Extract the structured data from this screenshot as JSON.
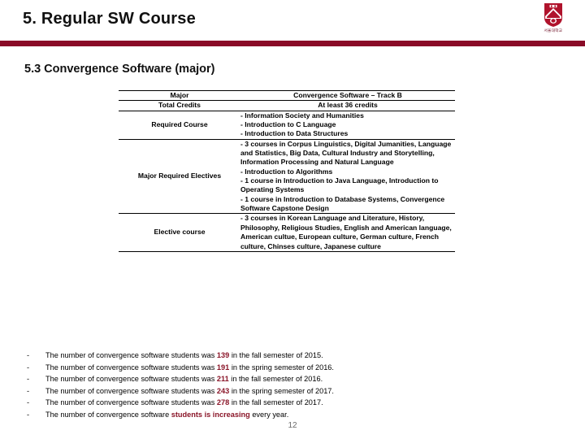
{
  "header": {
    "title": "5. Regular SW Course",
    "logo_icon": "university-crest-icon",
    "logo_caption": "서울대학교",
    "rule_color": "#8a0b27"
  },
  "section": {
    "heading": "5.3 Convergence Software (major)"
  },
  "table": {
    "rows": [
      {
        "label": "Major",
        "type": "single",
        "value": "Convergence Software – Track B"
      },
      {
        "label": "Total Credits",
        "type": "single",
        "value": "At least 36 credits"
      },
      {
        "label": "Required Course",
        "type": "list",
        "lines": [
          "- Information Society and Humanities",
          "- Introduction to C Language",
          "- Introduction to Data Structures"
        ]
      },
      {
        "label": "Major Required Electives",
        "type": "list",
        "lines": [
          "- 3 courses in Corpus Linguistics, Digital Jumanities, Language and Statistics, Big Data, Cultural Industry and Storytelling, Information Processing and Natural Language",
          "- Introduction to Algorithms",
          "- 1 course in Introduction to Java Language, Introduction to Operating Systems",
          "- 1 course in Introduction to Database Systems, Convergence Software Capstone Design"
        ]
      },
      {
        "label": "Elective course",
        "type": "list",
        "lines": [
          "- 3 courses in Korean Language and Literature, History, Philosophy, Religious Studies, English and American language, American cultue, European culture, German culture, French culture, Chinses culture, Japanese culture"
        ]
      }
    ]
  },
  "notes": {
    "dash": "-",
    "highlight_color": "#8a1528",
    "items": [
      {
        "pre": "The number of convergence software students was ",
        "hl": "139",
        "post": " in the fall semester of 2015."
      },
      {
        "pre": "The number of convergence software students was ",
        "hl": "191",
        "post": " in the spring semester of 2016."
      },
      {
        "pre": "The number of convergence software students was ",
        "hl": "211",
        "post": " in the fall semester of 2016."
      },
      {
        "pre": "The number of convergence software students was ",
        "hl": "243",
        "post": " in the spring semester of 2017."
      },
      {
        "pre": "The number of convergence software students was ",
        "hl": "278",
        "post": " in the fall semester of 2017."
      },
      {
        "pre": "The number of convergence software ",
        "hl": "students is increasing",
        "post": " every year."
      }
    ]
  },
  "footer": {
    "page_number": "12"
  }
}
